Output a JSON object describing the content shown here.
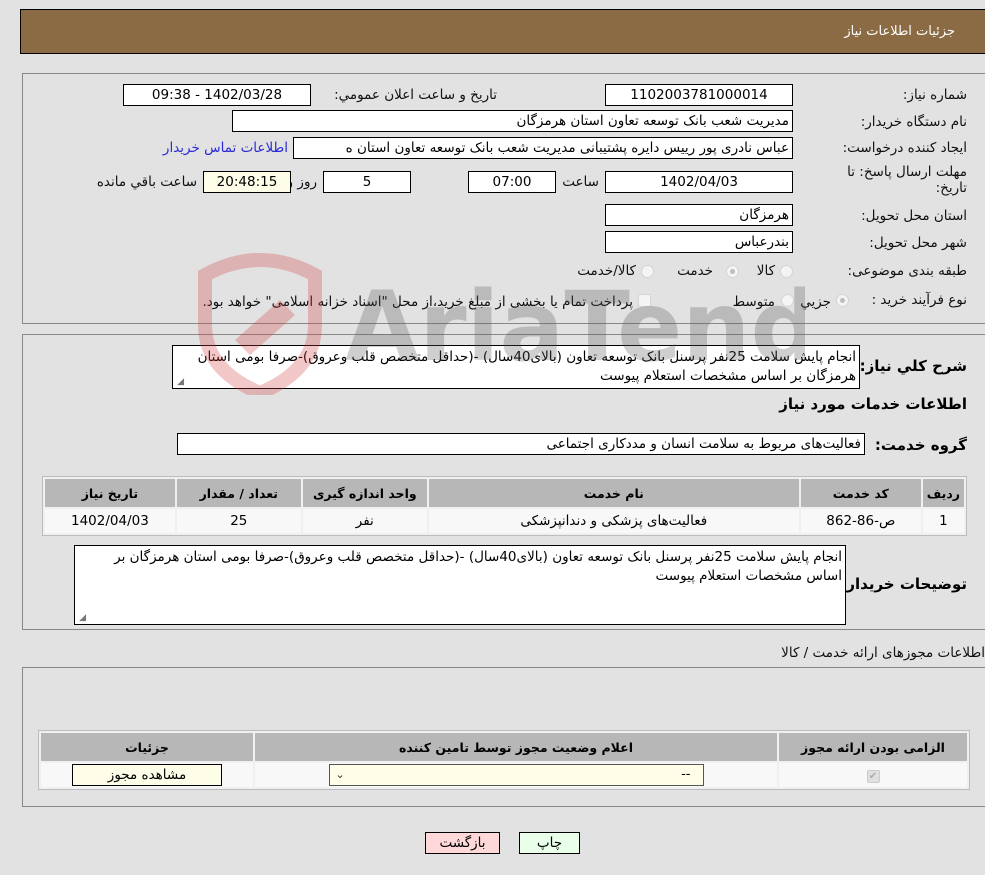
{
  "header": {
    "title": "جزئيات اطلاعات نياز"
  },
  "details": {
    "need_number_label": "شماره نياز:",
    "need_number": "1102003781000014",
    "announce_label": "تاريخ و ساعت اعلان عمومي:",
    "announce_value": "1402/03/28 - 09:38",
    "buyer_org_label": "نام دستگاه خريدار:",
    "buyer_org": "مديريت شعب بانک توسعه تعاون استان هرمزگان",
    "creator_label": "ايجاد کننده درخواست:",
    "creator": "عباس نادری پور رييس دايره پشتيبانی مديريت شعب بانک توسعه تعاون استان ه",
    "contact_link": "اطلاعات تماس خريدار",
    "deadline_label_line1": "مهلت ارسال پاسخ: تا",
    "deadline_label_line2": "تاريخ:",
    "deadline_date": "1402/04/03",
    "time_label": "ساعت",
    "deadline_time": "07:00",
    "days_value": "5",
    "days_label": "روز و",
    "remaining_time": "20:48:15",
    "remaining_label": "ساعت باقي مانده",
    "province_label": "استان محل تحويل:",
    "province": "هرمزگان",
    "city_label": "شهر محل تحويل:",
    "city": "بندرعباس",
    "category_label": "طبقه بندی موضوعی:",
    "category_options": [
      {
        "label": "کالا",
        "selected": false
      },
      {
        "label": "خدمت",
        "selected": true
      },
      {
        "label": "کالا/خدمت",
        "selected": false
      }
    ],
    "process_label": "نوع فرآيند خريد :",
    "process_options": [
      {
        "label": "جزيي",
        "selected": true
      },
      {
        "label": "متوسط",
        "selected": false
      }
    ],
    "treasury_note": "پرداخت تمام يا بخشی از مبلغ خريد،از محل \"اسناد خزانه اسلامی\" خواهد بود."
  },
  "summary": {
    "label": "شرح کلي نياز:",
    "text": "انجام پايش سلامت 25نفر پرسنل بانک توسعه تعاون (بالای40سال) -(حداقل متخصص قلب وعروق)-صرفا بومی استان هرمزگان بر اساس مشخصات استعلام پيوست",
    "services_title": "اطلاعات خدمات مورد نياز",
    "service_group_label": "گروه خدمت:",
    "service_group": "فعاليت‌های مربوط به سلامت انسان و مددکاری اجتماعی",
    "table": {
      "headers": [
        "رديف",
        "کد خدمت",
        "نام خدمت",
        "واحد اندازه گيری",
        "تعداد / مقدار",
        "تاريخ نياز"
      ],
      "rows": [
        [
          "1",
          "ص-86-862",
          "فعاليت‌های پزشکی و دندانپزشکی",
          "نفر",
          "25",
          "1402/04/03"
        ]
      ]
    },
    "buyer_notes_label": "توضيحات خريدار:",
    "buyer_notes": "انجام پايش سلامت 25نفر پرسنل بانک توسعه تعاون (بالای40سال) -(حداقل متخصص قلب وعروق)-صرفا بومی استان هرمزگان بر اساس مشخصات استعلام پيوست"
  },
  "permits": {
    "title": "اطلاعات مجوزهای ارائه خدمت / کالا",
    "headers": [
      "الزامی بودن ارائه مجوز",
      "اعلام وضعيت مجوز توسط تامين کننده",
      "جزئيات"
    ],
    "row": {
      "required_checked": true,
      "status_value": "--",
      "details_button": "مشاهده مجوز"
    }
  },
  "footer": {
    "print_button": "چاپ",
    "back_button": "بازگشت"
  },
  "watermark": {
    "text": "AriaTender.neT"
  },
  "colors": {
    "header_bg": "#8b6b43",
    "print_bg": "#eaffea",
    "back_bg": "#ffd9d9",
    "link": "#2a2ad8"
  }
}
